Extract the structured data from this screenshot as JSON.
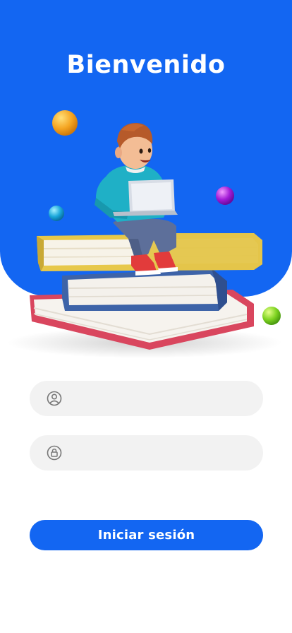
{
  "header": {
    "title": "Bienvenido"
  },
  "form": {
    "username": {
      "value": "",
      "placeholder": "",
      "icon": "user-circle-icon"
    },
    "password": {
      "value": "",
      "placeholder": "",
      "icon": "lock-icon"
    },
    "submit_label": "Iniciar sesión"
  },
  "colors": {
    "primary": "#1366f2",
    "field_bg": "#f2f2f2",
    "icon": "#777777"
  }
}
